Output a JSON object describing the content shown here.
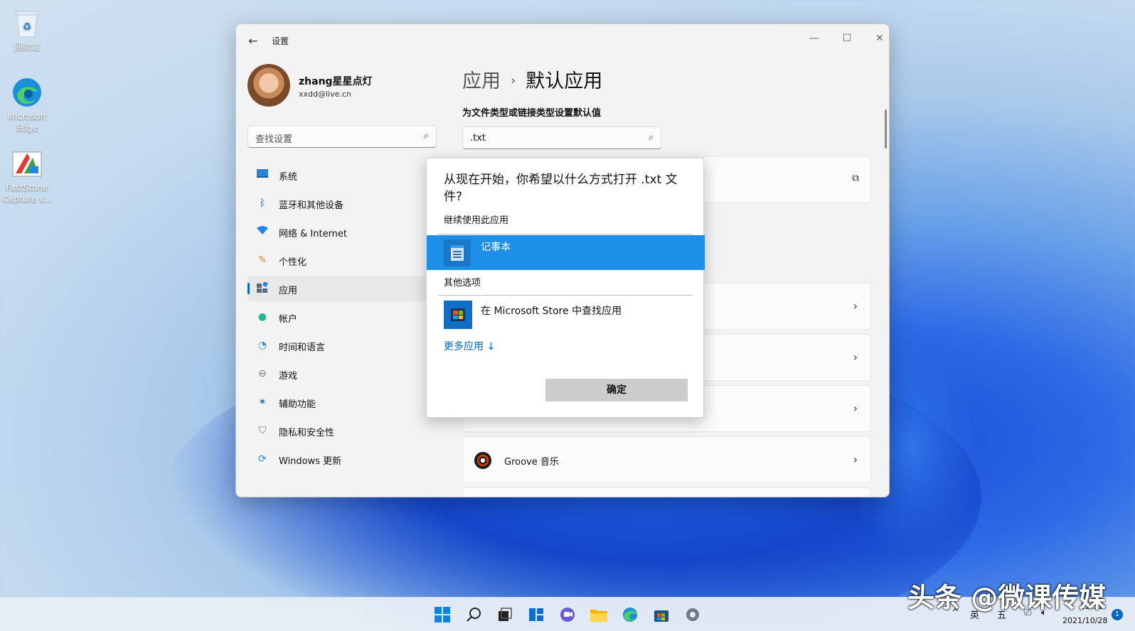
{
  "desktop": {
    "icons": [
      {
        "label": "回收站"
      },
      {
        "label": "Microsoft Edge"
      },
      {
        "label": "FastStone Capture v..."
      }
    ]
  },
  "window": {
    "title": "设置",
    "controls": {
      "minimize": "—",
      "maximize": "☐",
      "close": "✕"
    }
  },
  "profile": {
    "name": "zhang星星点灯",
    "email": "xxdd@live.cn"
  },
  "search": {
    "placeholder": "查找设置"
  },
  "nav": {
    "items": [
      {
        "label": "系统",
        "icon": "monitor-icon"
      },
      {
        "label": "蓝牙和其他设备",
        "icon": "bluetooth-icon"
      },
      {
        "label": "网络 & Internet",
        "icon": "wifi-icon"
      },
      {
        "label": "个性化",
        "icon": "brush-icon"
      },
      {
        "label": "应用",
        "icon": "apps-icon"
      },
      {
        "label": "帐户",
        "icon": "person-icon"
      },
      {
        "label": "时间和语言",
        "icon": "clock-globe-icon"
      },
      {
        "label": "游戏",
        "icon": "gamepad-icon"
      },
      {
        "label": "辅助功能",
        "icon": "accessibility-icon"
      },
      {
        "label": "隐私和安全性",
        "icon": "shield-icon"
      },
      {
        "label": "Windows 更新",
        "icon": "update-icon"
      }
    ],
    "active_index": 4
  },
  "content": {
    "breadcrumb_parent": "应用",
    "breadcrumb_sep": "›",
    "breadcrumb_current": "默认应用",
    "subtitle": "为文件类型或链接类型设置默认值",
    "ext_search_value": ".txt",
    "cards": [
      {
        "label": "",
        "trail": "external-link-icon"
      },
      {
        "label": "",
        "trail": "chevron-right-icon"
      },
      {
        "label": "",
        "trail": "chevron-right-icon"
      },
      {
        "label": "",
        "trail": "chevron-right-icon"
      },
      {
        "label": "Groove 音乐",
        "trail": "chevron-right-icon"
      }
    ]
  },
  "dialog": {
    "question": "从现在开始，你希望以什么方式打开 .txt 文件?",
    "continue_header": "继续使用此应用",
    "selected_app": "记事本",
    "other_header": "其他选项",
    "store_option": "在 Microsoft Store 中查找应用",
    "more_apps": "更多应用 ↓",
    "ok": "确定"
  },
  "taskbar": {
    "tray": {
      "chevron": "^",
      "lang": "英",
      "ime": "五"
    },
    "time": "22:31",
    "date": "2021/10/28",
    "notifications": "1"
  },
  "watermark": "头条 @微课传媒",
  "colors": {
    "accent": "#0067c0",
    "selection": "#1e8fe6",
    "window_bg": "#f3f3f3"
  }
}
